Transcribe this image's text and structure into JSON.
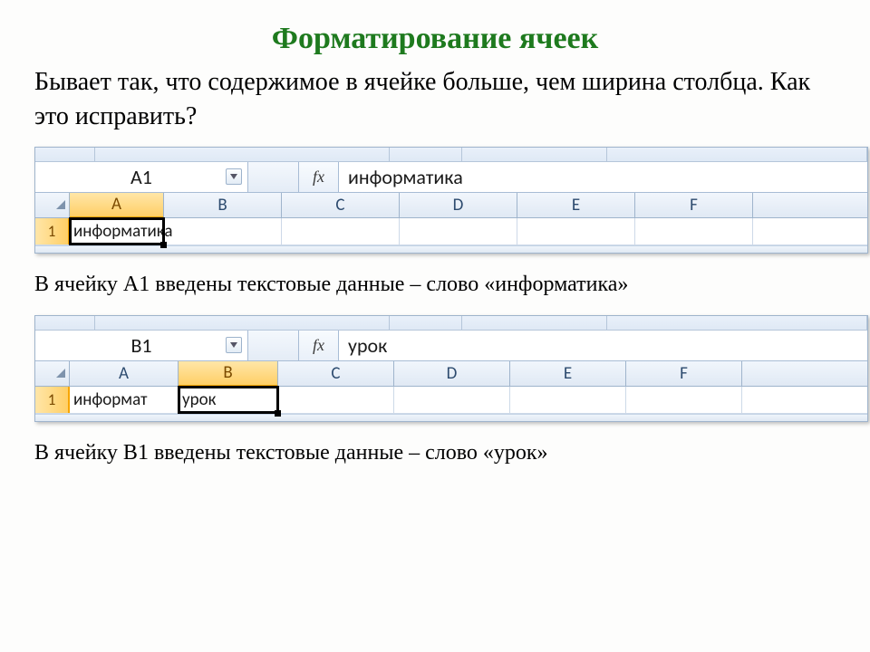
{
  "title": "Форматирование ячеек",
  "intro": "Бывает так, что содержимое в ячейке больше, чем ширина столбца. Как это исправить?",
  "caption1": "В ячейку А1 введены текстовые данные – слово «информатика»",
  "caption2": "В ячейку В1 введены текстовые данные – слово «урок»",
  "fx_label": "fx",
  "shot1": {
    "namebox": "A1",
    "formula": "информатика",
    "cols": [
      "A",
      "B",
      "C",
      "D",
      "E",
      "F"
    ],
    "row_num": "1",
    "a1_text": "информатика"
  },
  "shot2": {
    "namebox": "B1",
    "formula": "урок",
    "cols": [
      "A",
      "B",
      "C",
      "D",
      "E",
      "F"
    ],
    "row_num": "1",
    "a1_text": "информат",
    "b1_text": "урок"
  }
}
